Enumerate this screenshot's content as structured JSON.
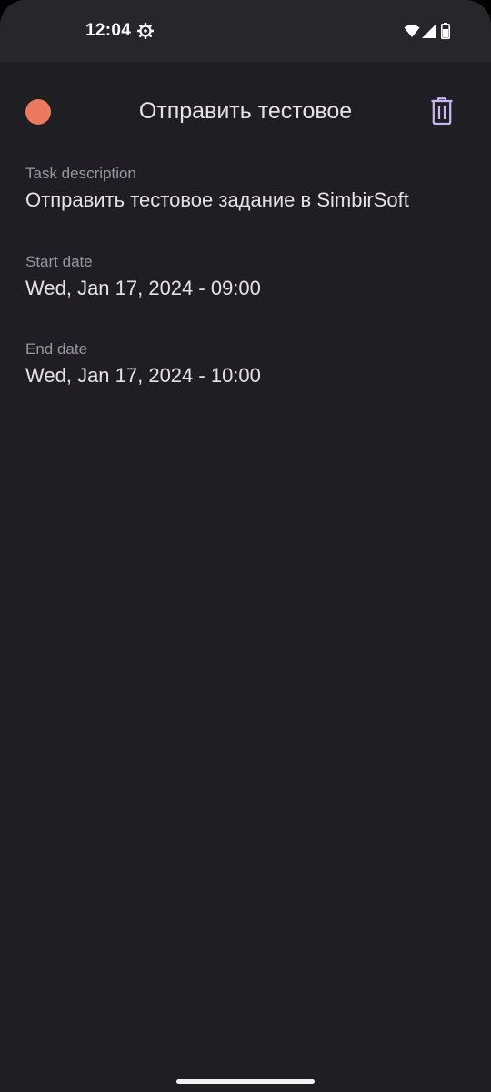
{
  "status_bar": {
    "time": "12:04",
    "icons": [
      "gear-icon",
      "wifi-icon",
      "signal-icon",
      "battery-icon"
    ]
  },
  "header": {
    "title": "Отправить тестовое",
    "color_dot": "#ec7a5e",
    "delete_icon": "trash-icon",
    "accent": "#c9b6f3"
  },
  "fields": {
    "description": {
      "label": "Task description",
      "value": "Отправить тестовое задание в SimbirSoft"
    },
    "start": {
      "label": "Start date",
      "value": "Wed, Jan 17, 2024 - 09:00"
    },
    "end": {
      "label": "End date",
      "value": "Wed, Jan 17, 2024 - 10:00"
    }
  },
  "theme": {
    "background": "#1f1f23",
    "status_bar": "#27272b",
    "text_primary": "#e6e1e6",
    "text_secondary": "#9a969e"
  }
}
